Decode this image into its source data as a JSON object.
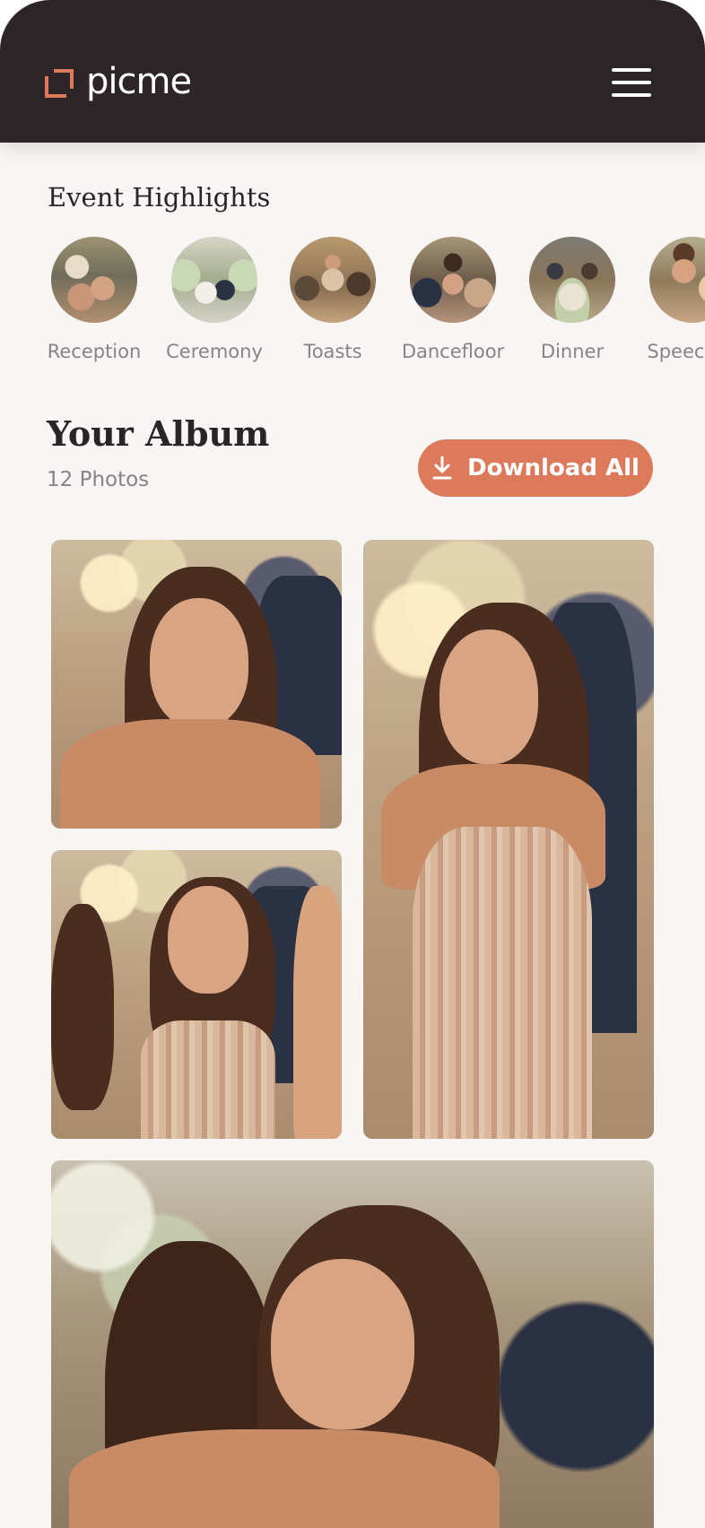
{
  "header": {
    "logo_text": "picme",
    "menu_icon": "hamburger-menu-icon",
    "colors": {
      "background": "#2d2527",
      "logo_accent": "#dc7a5b"
    }
  },
  "highlights": {
    "title": "Event Highlights",
    "items": [
      {
        "label": "Reception"
      },
      {
        "label": "Ceremony"
      },
      {
        "label": "Toasts"
      },
      {
        "label": "Dancefloor"
      },
      {
        "label": "Dinner"
      },
      {
        "label": "Speeches"
      }
    ]
  },
  "album": {
    "title": "Your Album",
    "count": "12 Photos",
    "download_label": "Download All",
    "download_icon": "download-icon",
    "accent": "#dc7a5b"
  }
}
